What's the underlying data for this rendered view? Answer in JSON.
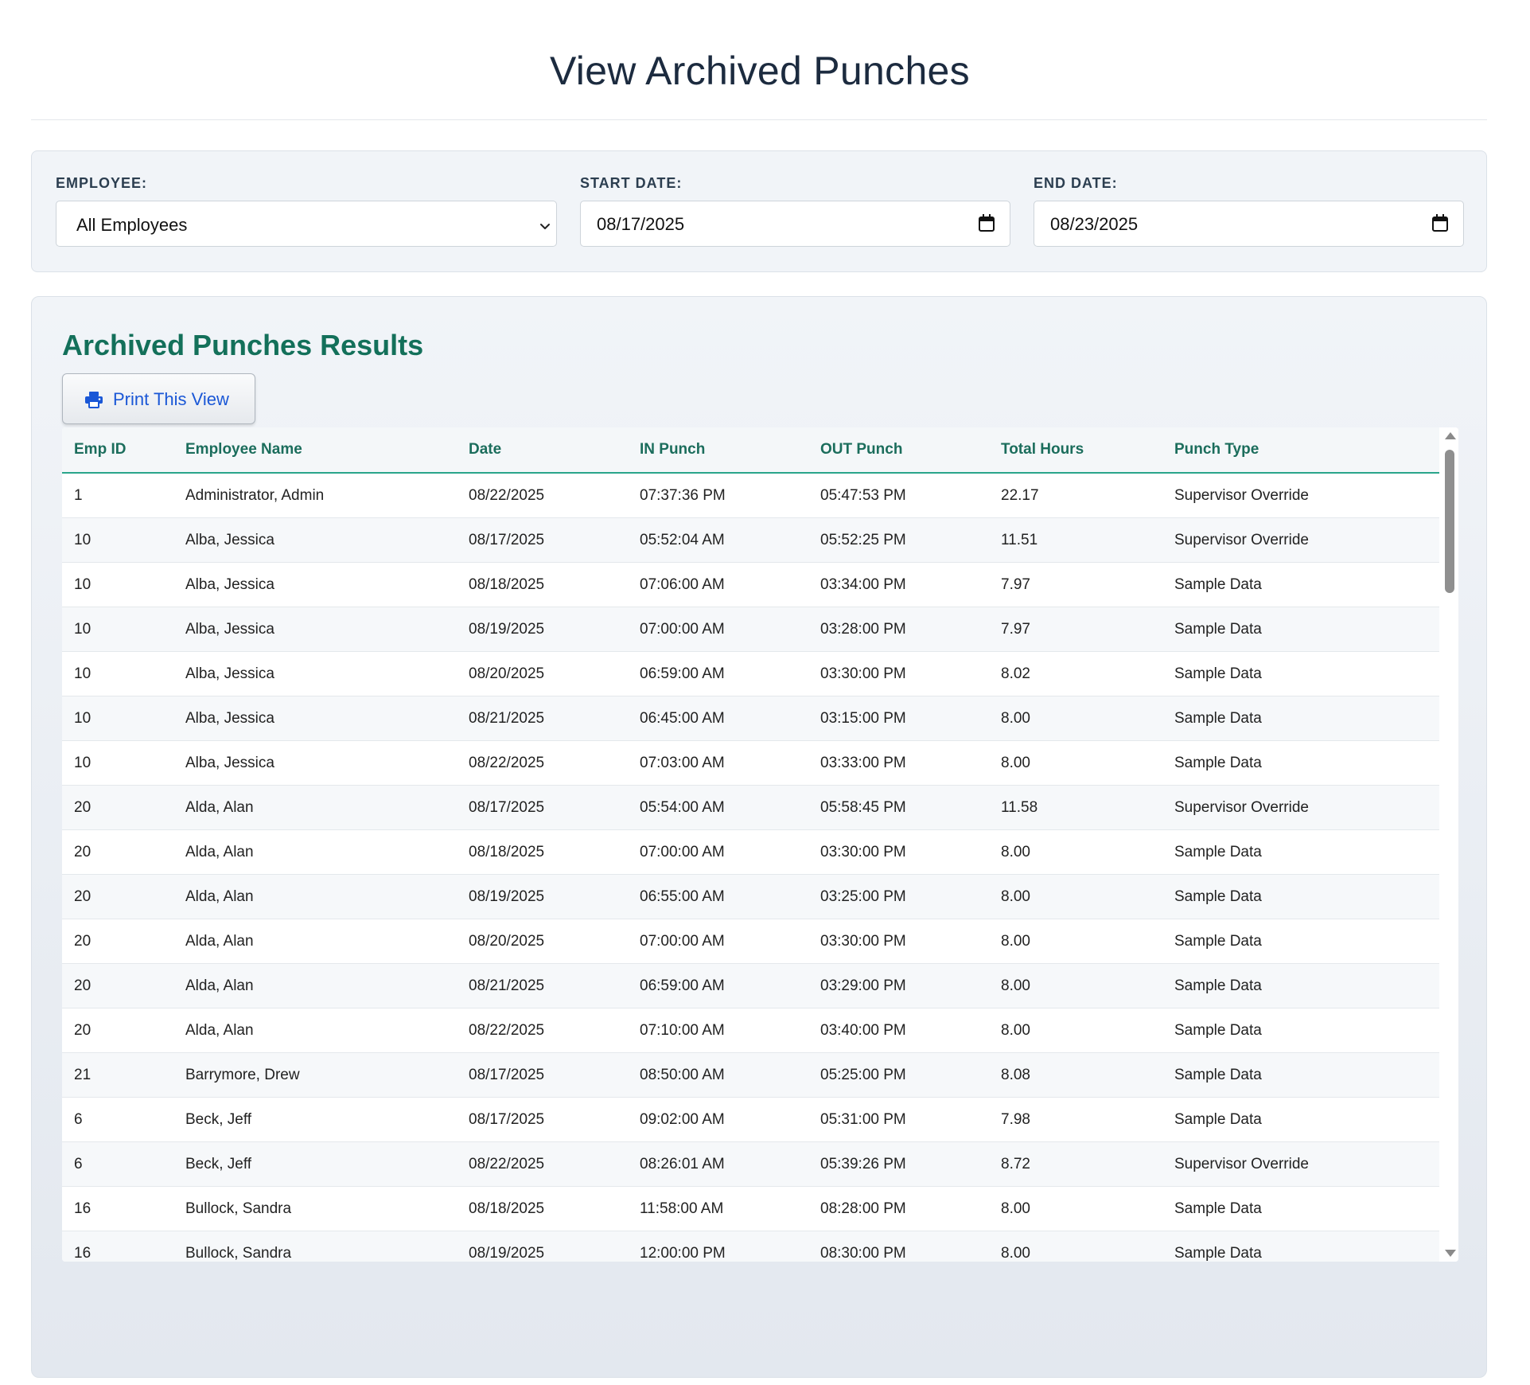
{
  "page": {
    "title": "View Archived Punches"
  },
  "filters": {
    "employee": {
      "label": "EMPLOYEE:",
      "selected": "All Employees",
      "icon": "chevron-down-icon"
    },
    "start_date": {
      "label": "START DATE:",
      "value": "08/17/2025",
      "icon": "calendar-icon"
    },
    "end_date": {
      "label": "END DATE:",
      "value": "08/23/2025",
      "icon": "calendar-icon"
    }
  },
  "results": {
    "title": "Archived Punches Results",
    "print_label": "Print This View",
    "print_icon": "printer-icon",
    "columns": [
      "Emp ID",
      "Employee Name",
      "Date",
      "IN Punch",
      "OUT Punch",
      "Total Hours",
      "Punch Type"
    ],
    "rows": [
      [
        "1",
        "Administrator, Admin",
        "08/22/2025",
        "07:37:36 PM",
        "05:47:53 PM",
        "22.17",
        "Supervisor Override"
      ],
      [
        "10",
        "Alba, Jessica",
        "08/17/2025",
        "05:52:04 AM",
        "05:52:25 PM",
        "11.51",
        "Supervisor Override"
      ],
      [
        "10",
        "Alba, Jessica",
        "08/18/2025",
        "07:06:00 AM",
        "03:34:00 PM",
        "7.97",
        "Sample Data"
      ],
      [
        "10",
        "Alba, Jessica",
        "08/19/2025",
        "07:00:00 AM",
        "03:28:00 PM",
        "7.97",
        "Sample Data"
      ],
      [
        "10",
        "Alba, Jessica",
        "08/20/2025",
        "06:59:00 AM",
        "03:30:00 PM",
        "8.02",
        "Sample Data"
      ],
      [
        "10",
        "Alba, Jessica",
        "08/21/2025",
        "06:45:00 AM",
        "03:15:00 PM",
        "8.00",
        "Sample Data"
      ],
      [
        "10",
        "Alba, Jessica",
        "08/22/2025",
        "07:03:00 AM",
        "03:33:00 PM",
        "8.00",
        "Sample Data"
      ],
      [
        "20",
        "Alda, Alan",
        "08/17/2025",
        "05:54:00 AM",
        "05:58:45 PM",
        "11.58",
        "Supervisor Override"
      ],
      [
        "20",
        "Alda, Alan",
        "08/18/2025",
        "07:00:00 AM",
        "03:30:00 PM",
        "8.00",
        "Sample Data"
      ],
      [
        "20",
        "Alda, Alan",
        "08/19/2025",
        "06:55:00 AM",
        "03:25:00 PM",
        "8.00",
        "Sample Data"
      ],
      [
        "20",
        "Alda, Alan",
        "08/20/2025",
        "07:00:00 AM",
        "03:30:00 PM",
        "8.00",
        "Sample Data"
      ],
      [
        "20",
        "Alda, Alan",
        "08/21/2025",
        "06:59:00 AM",
        "03:29:00 PM",
        "8.00",
        "Sample Data"
      ],
      [
        "20",
        "Alda, Alan",
        "08/22/2025",
        "07:10:00 AM",
        "03:40:00 PM",
        "8.00",
        "Sample Data"
      ],
      [
        "21",
        "Barrymore, Drew",
        "08/17/2025",
        "08:50:00 AM",
        "05:25:00 PM",
        "8.08",
        "Sample Data"
      ],
      [
        "6",
        "Beck, Jeff",
        "08/17/2025",
        "09:02:00 AM",
        "05:31:00 PM",
        "7.98",
        "Sample Data"
      ],
      [
        "6",
        "Beck, Jeff",
        "08/22/2025",
        "08:26:01 AM",
        "05:39:26 PM",
        "8.72",
        "Supervisor Override"
      ],
      [
        "16",
        "Bullock, Sandra",
        "08/18/2025",
        "11:58:00 AM",
        "08:28:00 PM",
        "8.00",
        "Sample Data"
      ],
      [
        "16",
        "Bullock, Sandra",
        "08/19/2025",
        "12:00:00 PM",
        "08:30:00 PM",
        "8.00",
        "Sample Data"
      ]
    ]
  },
  "colors": {
    "accent_green": "#13705a",
    "header_text": "#1b6d5c",
    "link_blue": "#1a57d6",
    "panel_bg": "#f1f4f8"
  }
}
